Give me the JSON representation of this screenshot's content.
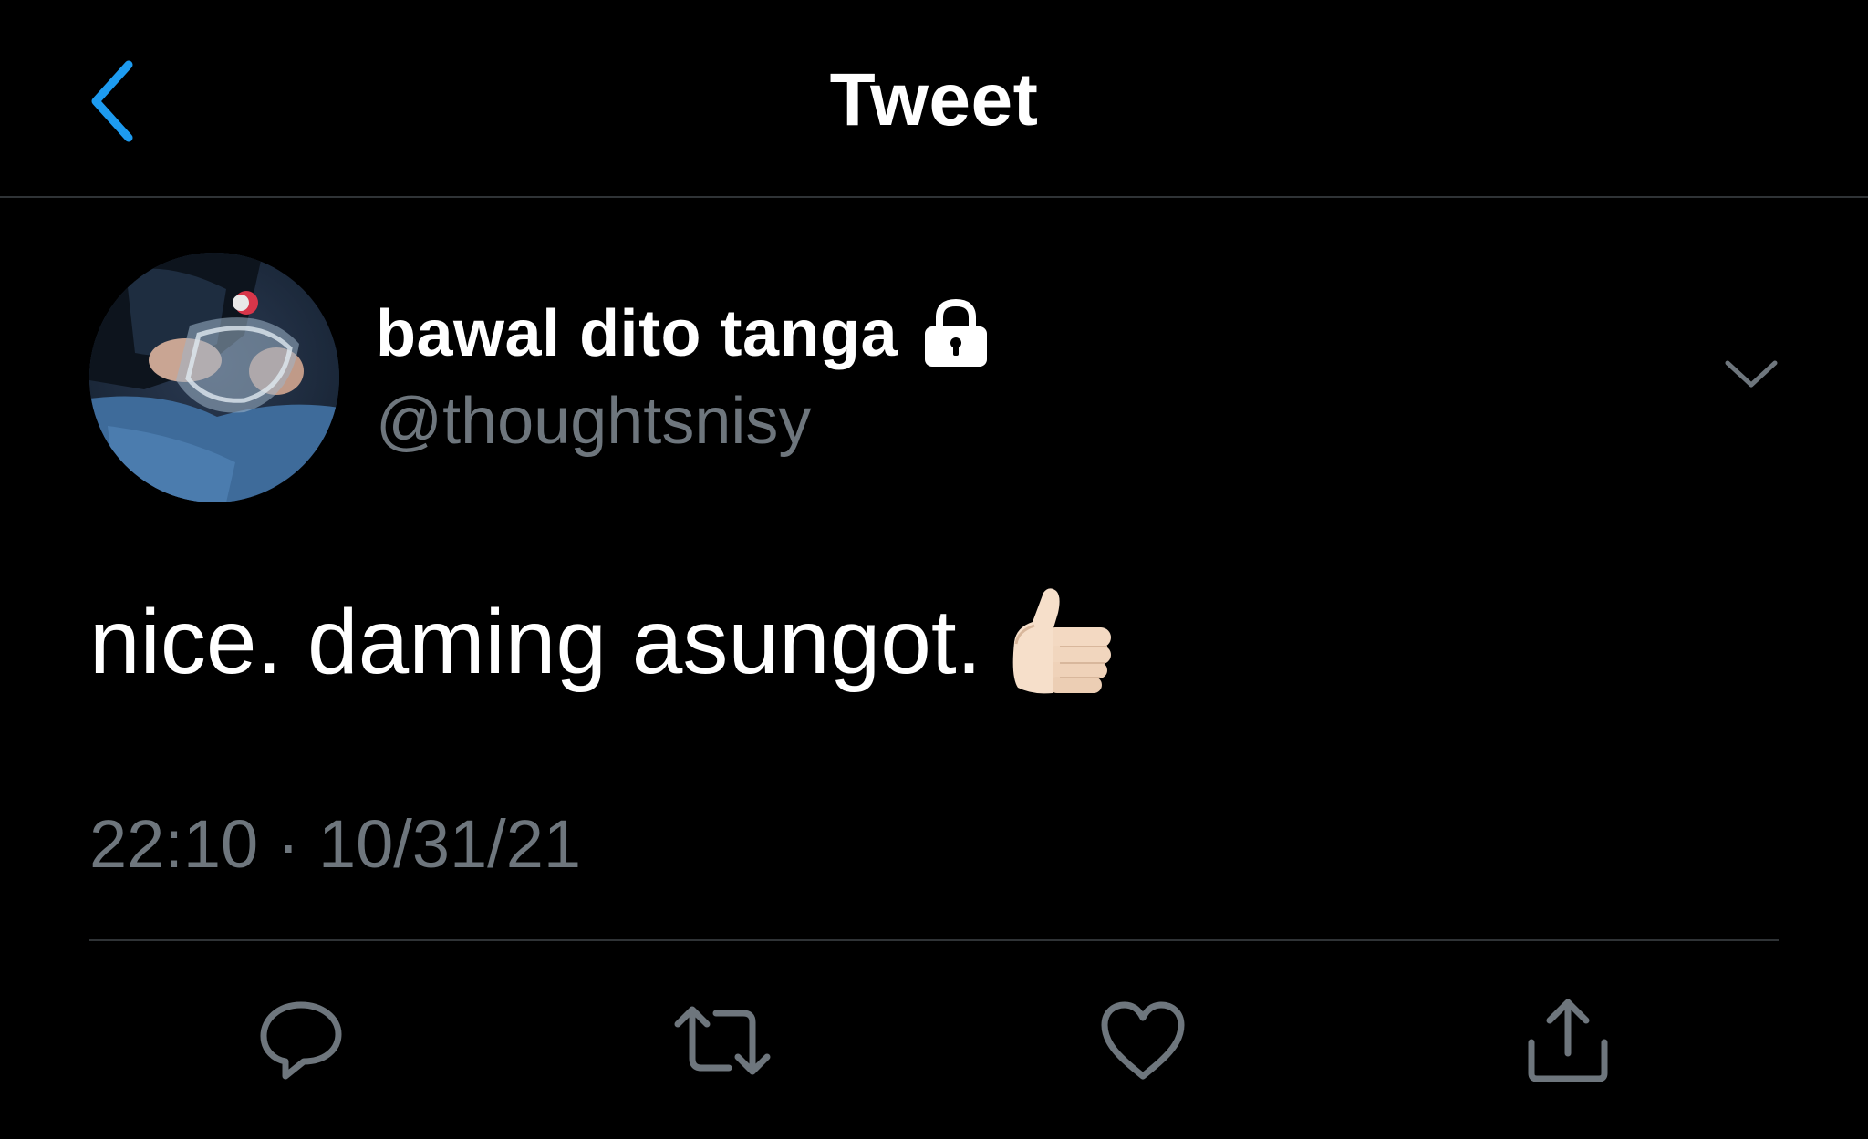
{
  "header": {
    "title": "Tweet",
    "back_icon": "chevron-left-icon",
    "accent_color": "#1d9bf0"
  },
  "tweet": {
    "author": {
      "display_name": "bawal dito tanga",
      "handle": "@thoughtsnisy",
      "protected_icon": "lock-icon",
      "avatar": "profile-photo"
    },
    "text": "nice. daming asungot.",
    "emoji": "thumbs-up-light-skin-tone",
    "time": "22:10",
    "separator": "·",
    "date": "10/31/21",
    "menu_icon": "chevron-down-icon"
  },
  "actions": [
    {
      "name": "reply",
      "icon": "comment-icon"
    },
    {
      "name": "retweet",
      "icon": "retweet-icon"
    },
    {
      "name": "like",
      "icon": "heart-icon"
    },
    {
      "name": "share",
      "icon": "share-icon"
    }
  ],
  "colors": {
    "background": "#000000",
    "text": "#ffffff",
    "secondary_text": "#6e767d",
    "divider": "#2f3336"
  }
}
